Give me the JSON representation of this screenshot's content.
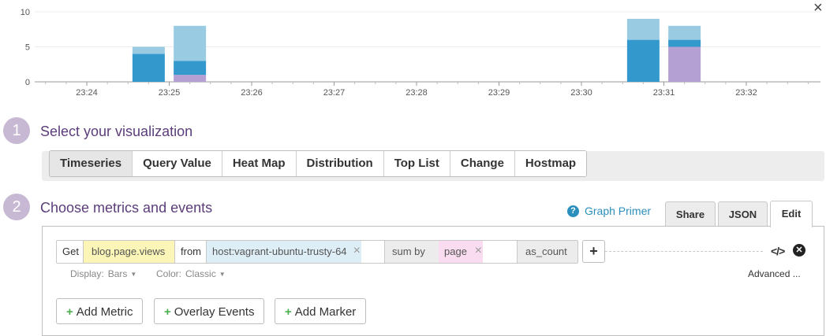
{
  "close_label": "×",
  "chart_data": {
    "type": "bar",
    "stacked": true,
    "x_ticks": [
      "23:24",
      "23:25",
      "23:26",
      "23:27",
      "23:28",
      "23:29",
      "23:30",
      "23:31",
      "23:32"
    ],
    "y_ticks": [
      0,
      5,
      10
    ],
    "ylim": [
      0,
      10
    ],
    "bars": [
      {
        "x": "23:24:45",
        "series_values": [
          0,
          4,
          1
        ]
      },
      {
        "x": "23:25:15",
        "series_values": [
          1,
          2,
          5
        ]
      },
      {
        "x": "23:30:45",
        "series_values": [
          0,
          6,
          3
        ]
      },
      {
        "x": "23:31:15",
        "series_values": [
          5,
          1,
          2
        ]
      }
    ],
    "colors": [
      "#b4a0d2",
      "#3399cc",
      "#99cce3"
    ],
    "grid": true
  },
  "steps": [
    {
      "number": "1",
      "title": "Select your visualization"
    },
    {
      "number": "2",
      "title": "Choose metrics and events"
    }
  ],
  "visualizations": {
    "selected": "Timeseries",
    "options": [
      "Timeseries",
      "Query Value",
      "Heat Map",
      "Distribution",
      "Top List",
      "Change",
      "Hostmap"
    ]
  },
  "graph_primer": {
    "icon": "question-icon",
    "label": "Graph Primer"
  },
  "tabs": [
    "Share",
    "JSON",
    "Edit"
  ],
  "active_tab": "Edit",
  "query": {
    "get_label": "Get",
    "metric": "blog.page.views",
    "from_label": "from",
    "host": "host:vagrant-ubuntu-trusty-64",
    "sum_by_label": "sum by",
    "group": "page",
    "function": "as_count",
    "remove_glyph": "×",
    "add_glyph": "+"
  },
  "options": {
    "display_label": "Display:",
    "display_value": "Bars",
    "color_label": "Color:",
    "color_value": "Classic",
    "caret": "▼",
    "advanced": "Advanced ..."
  },
  "icons": {
    "code": "</>",
    "remove": "✕"
  },
  "buttons": {
    "plus": "+",
    "add_metric": "Add Metric",
    "overlay_events": "Overlay Events",
    "add_marker": "Add Marker"
  }
}
